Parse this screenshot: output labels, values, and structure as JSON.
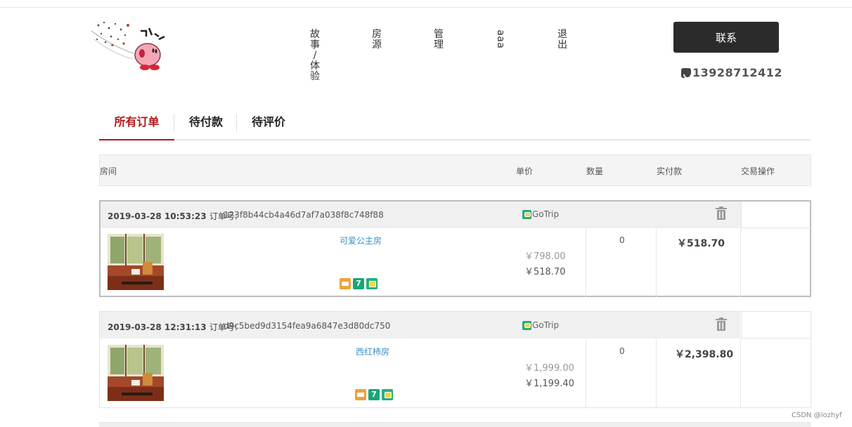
{
  "header": {
    "logo_alt": "logo",
    "nav": [
      {
        "chars": [
          "故",
          "事",
          "/",
          "体",
          "验"
        ]
      },
      {
        "chars": [
          "房",
          "源"
        ]
      },
      {
        "chars": [
          "管",
          "理"
        ]
      },
      {
        "chars": [
          "a",
          "a",
          "a"
        ]
      },
      {
        "chars": [
          "退",
          "出"
        ]
      }
    ],
    "contact_label": "联系",
    "phone": "13928712412"
  },
  "tabs": [
    {
      "label": "所有订单",
      "active": true
    },
    {
      "label": "待付款",
      "active": false
    },
    {
      "label": "待评价",
      "active": false
    }
  ],
  "table_header": {
    "room": "房间",
    "unit_price": "单价",
    "quantity": "数量",
    "paid": "实付款",
    "actions": "交易操作"
  },
  "orders": [
    {
      "date": "2019-03-28 10:53:23",
      "order_label": "订单号:",
      "order_no": "123f8b44cb4a46d7af7a038f8c748f88",
      "shop": "GoTrip",
      "room_name": "可爱公主房",
      "original_price": "￥798.00",
      "price": "￥518.70",
      "quantity": "0",
      "paid": "￥518.70"
    },
    {
      "date": "2019-03-28 12:31:13",
      "order_label": "订单号:",
      "order_no": "d9c5bed9d3154fea9a6847e3d80dc750",
      "shop": "GoTrip",
      "room_name": "西红柿房",
      "original_price": "￥1,999.00",
      "price": "￥1,199.40",
      "quantity": "0",
      "paid": "￥2,398.80"
    }
  ],
  "badges": {
    "seven": "7"
  },
  "watermark": "CSDN @lozhyf",
  "colors": {
    "accent": "#b0171c",
    "button": "#2b2b2b",
    "link": "#3c8fc4"
  }
}
